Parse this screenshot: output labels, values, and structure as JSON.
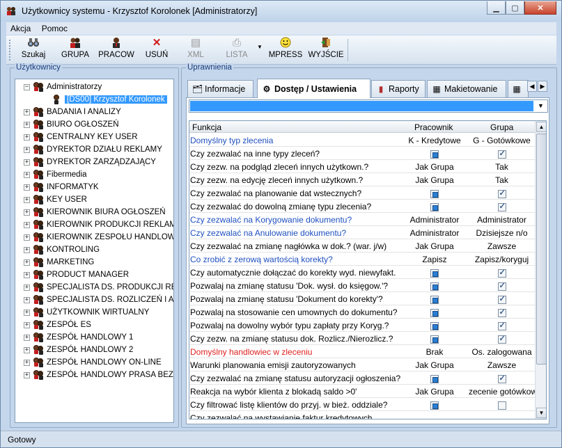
{
  "window": {
    "title": "Użytkownicy systemu - Krzysztof Korolonek [Administratorzy]",
    "minimize_icon": "minimize-icon",
    "maximize_icon": "maximize-icon",
    "close_icon": "close-icon"
  },
  "menu": [
    "Akcja",
    "Pomoc"
  ],
  "toolbar": {
    "buttons": [
      {
        "label": "Szukaj",
        "icon": "binoculars-icon"
      },
      {
        "label": "GRUPA",
        "icon": "group-icon"
      },
      {
        "label": "PRACOW",
        "icon": "user-icon"
      },
      {
        "label": "USUŃ",
        "icon": "delete-x-icon"
      },
      {
        "label": "XML",
        "icon": "xml-icon",
        "disabled": true
      },
      {
        "label": "LISTA",
        "icon": "printer-icon",
        "disabled": true
      },
      {
        "label": "MPRESS",
        "icon": "smiley-icon"
      },
      {
        "label": "WYJŚCIE",
        "icon": "exit-door-icon"
      }
    ]
  },
  "left_panel": {
    "title": "Użytkownicy",
    "tree": {
      "root": "Administratorzy",
      "selected": "[DS00] Krzysztof Korolonek",
      "groups": [
        "BADANIA I ANALIZY",
        "BIURO OGŁOSZEŃ",
        "CENTRALNY KEY USER",
        "DYREKTOR DZIAŁU REKLAMY",
        "DYREKTOR ZARZĄDZAJĄCY",
        "Fibermedia",
        "INFORMATYK",
        "KEY USER",
        "KIEROWNIK BIURA OGŁOSZEŃ",
        "KIEROWNIK PRODUKCJI REKLAM",
        "KIEROWNIK ZESPOŁU HANDLOWEGO",
        "KONTROLING",
        "MARKETING",
        "PRODUCT MANAGER",
        "SPECJALISTA DS. PRODUKCJI REKLAM",
        "SPECJALISTA DS. ROZLICZEŃ I ANALIZ",
        "UŻYTKOWNIK WIRTUALNY",
        "ZESPÓŁ ES",
        "ZESPÓŁ HANDLOWY 1",
        "ZESPÓŁ HANDLOWY 2",
        "ZESPÓŁ HANDLOWY ON-LINE",
        "ZESPÓŁ HANDLOWY PRASA BEZPŁATNA"
      ]
    }
  },
  "right_panel": {
    "title": "Uprawnienia",
    "tabs": [
      {
        "label": "Informacje",
        "icon": "info-card-icon"
      },
      {
        "label": "Dostęp / Ustawienia",
        "icon": "settings-icon",
        "active": true
      },
      {
        "label": "Raporty",
        "icon": "bar-chart-icon"
      },
      {
        "label": "Makietowanie",
        "icon": "grid-layout-icon"
      }
    ],
    "grid": {
      "headers": {
        "function": "Funkcja",
        "employee": "Pracownik",
        "group": "Grupa"
      },
      "rows": [
        {
          "f": "Domyślny typ zlecenia",
          "p": "K - Kredytowe",
          "g": "G - Gotówkowe",
          "style": "blue"
        },
        {
          "f": "Czy zezwalać na inne typy zleceń?",
          "p": "[sq]",
          "g": "[ck]"
        },
        {
          "f": "Czy zezw. na podgląd zleceń innych użytkown.?",
          "p": "Jak Grupa",
          "g": "Tak"
        },
        {
          "f": "Czy zezw. na edycję zleceń innych użytkown.?",
          "p": "Jak Grupa",
          "g": "Tak"
        },
        {
          "f": "Czy zezwalać na planowanie dat wstecznych?",
          "p": "[sq]",
          "g": "[ck]"
        },
        {
          "f": "Czy zezwalać do dowolną zmianę typu zlecenia?",
          "p": "[sq]",
          "g": "[ck]"
        },
        {
          "f": "Czy zezwalać na Korygowanie dokumentu?",
          "p": "Administrator",
          "g": "Administrator",
          "style": "blue"
        },
        {
          "f": "Czy zezwalać na Anulowanie dokumentu?",
          "p": "Administrator",
          "g": "Dzisiejsze n/o",
          "style": "blue"
        },
        {
          "f": "Czy zezwalać na zmianę nagłówka w dok.? (war. j/w)",
          "p": "Jak Grupa",
          "g": "Zawsze"
        },
        {
          "f": "Co zrobić z zerową wartością korekty?",
          "p": "Zapisz",
          "g": "Zapisz/koryguj",
          "style": "blue"
        },
        {
          "f": "Czy automatycznie dołączać do korekty wyd. niewyfakt.",
          "p": "[sq]",
          "g": "[ck]"
        },
        {
          "f": "Pozwalaj na zmianę statusu 'Dok. wysł. do księgow.'?",
          "p": "[sq]",
          "g": "[ck]"
        },
        {
          "f": "Pozwalaj na zmianę statusu 'Dokument do korekty'?",
          "p": "[sq]",
          "g": "[ck]"
        },
        {
          "f": "Pozwalaj na stosowanie cen umownych do dokumentu?",
          "p": "[sq]",
          "g": "[ck]"
        },
        {
          "f": "Pozwalaj na dowolny wybór typu zapłaty przy Koryg.?",
          "p": "[sq]",
          "g": "[ck]"
        },
        {
          "f": "Czy zezw. na zmianę statusu dok. Rozlicz./Nierozlicz.?",
          "p": "[sq]",
          "g": "[ck]"
        },
        {
          "f": "Domyślny handlowiec w zleceniu",
          "p": "Brak",
          "g": "Os. zalogowana",
          "style": "red"
        },
        {
          "f": "Warunki planowania emisji zautoryzowanych",
          "p": "Jak Grupa",
          "g": "Zawsze"
        },
        {
          "f": "Czy zezwalać na zmianę statusu autoryzacji ogłoszenia?",
          "p": "[sq]",
          "g": "[ck]"
        },
        {
          "f": "Reakcja na wybór klienta z blokadą saldo >0'",
          "p": "Jak Grupa",
          "g": "zecenie gotówkow"
        },
        {
          "f": "Czy filtrować listę klientów do przyj. w bież. oddziale?",
          "p": "[sq]",
          "g": "[empty]"
        },
        {
          "f": "Czy zezwalać na wystawianie faktur kredytowych",
          "p": "",
          "g": ""
        }
      ]
    }
  },
  "status_bar": "Gotowy"
}
